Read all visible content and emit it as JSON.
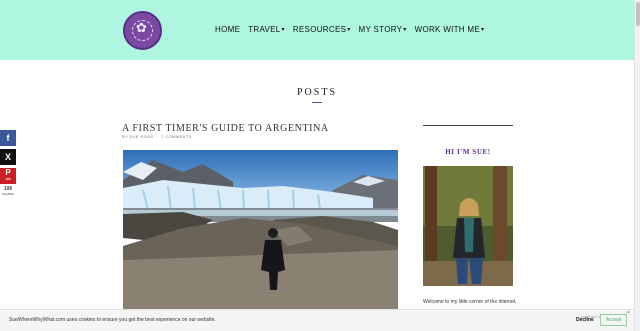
{
  "header": {
    "logo_alt": "Sue Where Why What",
    "nav": [
      {
        "label": "HOME",
        "caret": ""
      },
      {
        "label": "TRAVEL",
        "caret": "▾"
      },
      {
        "label": "RESOURCES",
        "caret": "▾"
      },
      {
        "label": "MY STORY",
        "caret": "▾"
      },
      {
        "label": "WORK WITH ME",
        "caret": "▾"
      }
    ]
  },
  "share": {
    "facebook_icon": "f",
    "x_icon": "X",
    "pinterest_icon": "P",
    "pinterest_count": "106",
    "total_count": "106",
    "total_label": "SHARES"
  },
  "main": {
    "section_title": "POSTS",
    "post": {
      "title": "A FIRST TIMER'S GUIDE TO ARGENTINA",
      "author": "BY SUE ROSS",
      "comments": "7 COMMENTS"
    }
  },
  "sidebar": {
    "heading": "HI I'M SUE!",
    "intro": "Welcome to my little corner of the internet,"
  },
  "cookie": {
    "text": "SueWhereWhyWhat.com uses cookies to ensure you get the best experience on our website.",
    "decline": "Decline",
    "accept": "Accept",
    "close": "×",
    "powered": "powered by"
  },
  "colors": {
    "header_bg": "#aff6e1",
    "accent_purple": "#5b2d90",
    "facebook": "#3b5998",
    "pinterest": "#cb2027"
  }
}
